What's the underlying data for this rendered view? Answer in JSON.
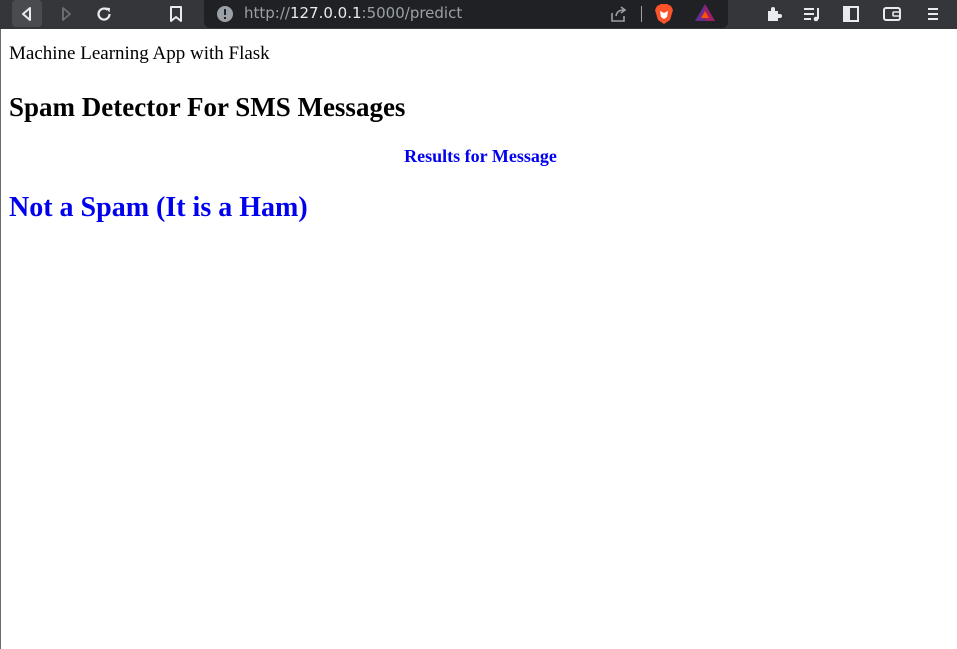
{
  "browser": {
    "url_scheme": "http://",
    "url_host": "127.0.0.1",
    "url_rest": ":5000/predict",
    "icons": [
      "back-icon",
      "forward-icon",
      "reload-icon",
      "bookmark-icon",
      "site-info-icon",
      "share-icon",
      "brave-shields-icon",
      "brave-rewards-icon",
      "extensions-icon",
      "playlist-icon",
      "sidebar-icon",
      "wallet-icon",
      "menu-icon"
    ],
    "colors": {
      "toolbar": "#35363a",
      "urlbar": "#202124",
      "brave_orange": "#fb542b"
    }
  },
  "page": {
    "brand": "Machine Learning App with Flask",
    "title": "Spam Detector For SMS Messages",
    "results_heading": "Results for Message",
    "result": "Not a Spam (It is a Ham)",
    "colors": {
      "result": "#0000ee"
    }
  }
}
